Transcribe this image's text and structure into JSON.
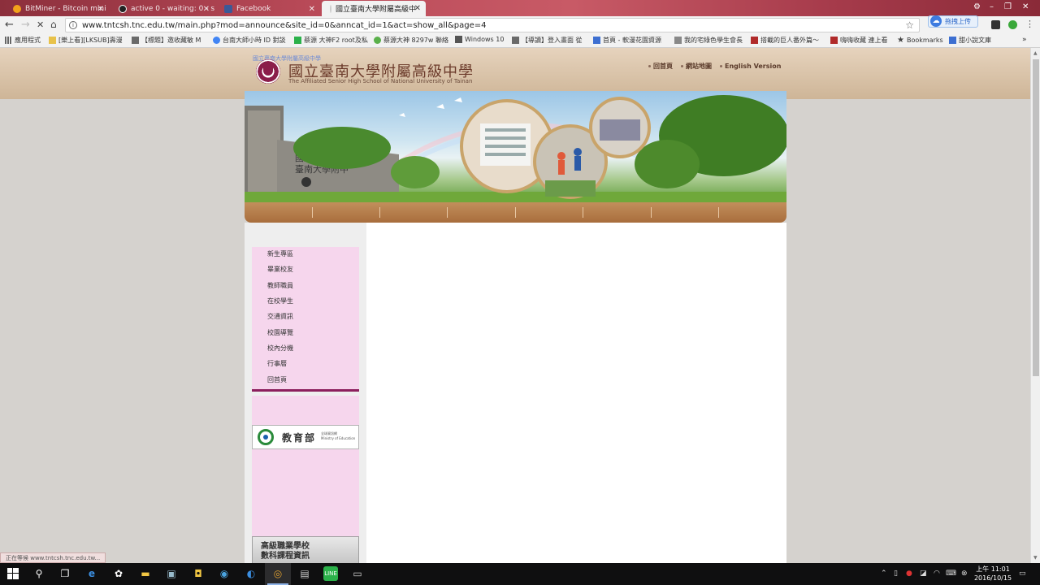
{
  "browser": {
    "tabs": [
      {
        "label": "BitMiner - Bitcoin mini",
        "icon": "bitcoin-favicon"
      },
      {
        "label": "active 0 - waiting: 0 - s",
        "icon": "torrent-favicon"
      },
      {
        "label": "Facebook",
        "icon": "facebook-favicon"
      },
      {
        "label": "國立臺南大學附屬高級中",
        "icon": "school-favicon",
        "active": true
      }
    ],
    "url": "www.tntcsh.tnc.edu.tw/main.php?mod=announce&site_id=0&anncat_id=1&act=show_all&page=4",
    "upload_badge": "拖拽上传",
    "bookmarks": [
      "應用程式",
      "[樂上看][LKSUB]壽漫",
      "【標題】邀收藏敏 M",
      "台南大師小時 ID 對談",
      "蔡源 大神F2 root及私",
      "蔡源大神 8297w 聯絡",
      "Windows 10",
      "【導讀】登入畫面 從",
      "首頁 - 軟漫花園資源",
      "我的宅綠色學生會長",
      "搭載的巨人番外篇～",
      "嗨嗨收藏 連上看",
      "Bookmarks",
      "甜小說文庫"
    ],
    "status_text": "正在等候 www.tntcsh.tnc.edu.tw..."
  },
  "site": {
    "alt_text": "國立臺南大學附屬高級中學",
    "school_name_zh": "國立臺南大學附屬高級中學",
    "school_name_en": "The Affiliated Senior High School of National University of Tainan",
    "top_links": [
      "回首頁",
      "網站地圖",
      "English Version"
    ],
    "sidenav": [
      "新生專區",
      "畢業校友",
      "教師職員",
      "在校學生",
      "交通資訊",
      "校園導覽",
      "校內分機",
      "行事曆",
      "回首頁"
    ],
    "moe_banner": {
      "zh": "教育部",
      "sub1": "全球資訊網",
      "sub2": "Ministry of Education"
    },
    "vocational_banner": {
      "line1": "高級職業學校",
      "line2": "數科課程資訊"
    }
  },
  "taskbar": {
    "time": "上午 11:01",
    "date": "2016/10/15"
  },
  "colors": {
    "menu_brown": "#b67a45",
    "sidenav_pink": "#f6d6ed",
    "sidenav_border": "#8c1f5d",
    "tabstrip_red": "#b94a58"
  }
}
